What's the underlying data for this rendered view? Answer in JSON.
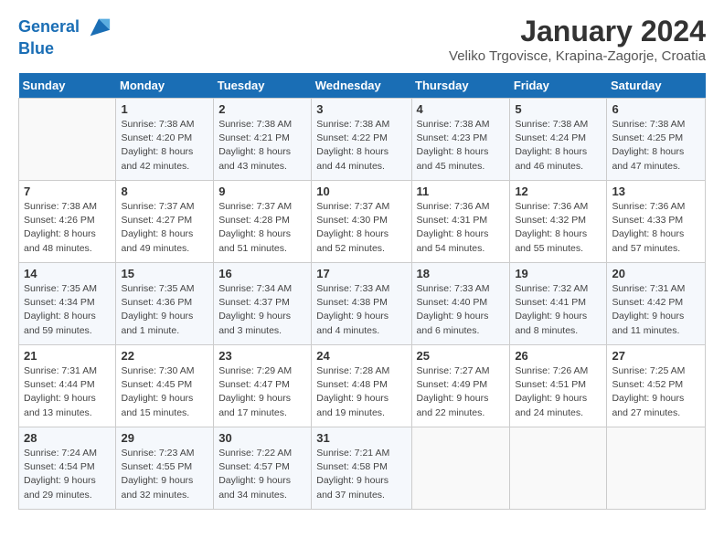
{
  "header": {
    "logo_line1": "General",
    "logo_line2": "Blue",
    "title": "January 2024",
    "subtitle": "Veliko Trgovisce, Krapina-Zagorje, Croatia"
  },
  "calendar": {
    "days_of_week": [
      "Sunday",
      "Monday",
      "Tuesday",
      "Wednesday",
      "Thursday",
      "Friday",
      "Saturday"
    ],
    "weeks": [
      [
        {
          "day": "",
          "info": ""
        },
        {
          "day": "1",
          "info": "Sunrise: 7:38 AM\nSunset: 4:20 PM\nDaylight: 8 hours\nand 42 minutes."
        },
        {
          "day": "2",
          "info": "Sunrise: 7:38 AM\nSunset: 4:21 PM\nDaylight: 8 hours\nand 43 minutes."
        },
        {
          "day": "3",
          "info": "Sunrise: 7:38 AM\nSunset: 4:22 PM\nDaylight: 8 hours\nand 44 minutes."
        },
        {
          "day": "4",
          "info": "Sunrise: 7:38 AM\nSunset: 4:23 PM\nDaylight: 8 hours\nand 45 minutes."
        },
        {
          "day": "5",
          "info": "Sunrise: 7:38 AM\nSunset: 4:24 PM\nDaylight: 8 hours\nand 46 minutes."
        },
        {
          "day": "6",
          "info": "Sunrise: 7:38 AM\nSunset: 4:25 PM\nDaylight: 8 hours\nand 47 minutes."
        }
      ],
      [
        {
          "day": "7",
          "info": "Sunrise: 7:38 AM\nSunset: 4:26 PM\nDaylight: 8 hours\nand 48 minutes."
        },
        {
          "day": "8",
          "info": "Sunrise: 7:37 AM\nSunset: 4:27 PM\nDaylight: 8 hours\nand 49 minutes."
        },
        {
          "day": "9",
          "info": "Sunrise: 7:37 AM\nSunset: 4:28 PM\nDaylight: 8 hours\nand 51 minutes."
        },
        {
          "day": "10",
          "info": "Sunrise: 7:37 AM\nSunset: 4:30 PM\nDaylight: 8 hours\nand 52 minutes."
        },
        {
          "day": "11",
          "info": "Sunrise: 7:36 AM\nSunset: 4:31 PM\nDaylight: 8 hours\nand 54 minutes."
        },
        {
          "day": "12",
          "info": "Sunrise: 7:36 AM\nSunset: 4:32 PM\nDaylight: 8 hours\nand 55 minutes."
        },
        {
          "day": "13",
          "info": "Sunrise: 7:36 AM\nSunset: 4:33 PM\nDaylight: 8 hours\nand 57 minutes."
        }
      ],
      [
        {
          "day": "14",
          "info": "Sunrise: 7:35 AM\nSunset: 4:34 PM\nDaylight: 8 hours\nand 59 minutes."
        },
        {
          "day": "15",
          "info": "Sunrise: 7:35 AM\nSunset: 4:36 PM\nDaylight: 9 hours\nand 1 minute."
        },
        {
          "day": "16",
          "info": "Sunrise: 7:34 AM\nSunset: 4:37 PM\nDaylight: 9 hours\nand 3 minutes."
        },
        {
          "day": "17",
          "info": "Sunrise: 7:33 AM\nSunset: 4:38 PM\nDaylight: 9 hours\nand 4 minutes."
        },
        {
          "day": "18",
          "info": "Sunrise: 7:33 AM\nSunset: 4:40 PM\nDaylight: 9 hours\nand 6 minutes."
        },
        {
          "day": "19",
          "info": "Sunrise: 7:32 AM\nSunset: 4:41 PM\nDaylight: 9 hours\nand 8 minutes."
        },
        {
          "day": "20",
          "info": "Sunrise: 7:31 AM\nSunset: 4:42 PM\nDaylight: 9 hours\nand 11 minutes."
        }
      ],
      [
        {
          "day": "21",
          "info": "Sunrise: 7:31 AM\nSunset: 4:44 PM\nDaylight: 9 hours\nand 13 minutes."
        },
        {
          "day": "22",
          "info": "Sunrise: 7:30 AM\nSunset: 4:45 PM\nDaylight: 9 hours\nand 15 minutes."
        },
        {
          "day": "23",
          "info": "Sunrise: 7:29 AM\nSunset: 4:47 PM\nDaylight: 9 hours\nand 17 minutes."
        },
        {
          "day": "24",
          "info": "Sunrise: 7:28 AM\nSunset: 4:48 PM\nDaylight: 9 hours\nand 19 minutes."
        },
        {
          "day": "25",
          "info": "Sunrise: 7:27 AM\nSunset: 4:49 PM\nDaylight: 9 hours\nand 22 minutes."
        },
        {
          "day": "26",
          "info": "Sunrise: 7:26 AM\nSunset: 4:51 PM\nDaylight: 9 hours\nand 24 minutes."
        },
        {
          "day": "27",
          "info": "Sunrise: 7:25 AM\nSunset: 4:52 PM\nDaylight: 9 hours\nand 27 minutes."
        }
      ],
      [
        {
          "day": "28",
          "info": "Sunrise: 7:24 AM\nSunset: 4:54 PM\nDaylight: 9 hours\nand 29 minutes."
        },
        {
          "day": "29",
          "info": "Sunrise: 7:23 AM\nSunset: 4:55 PM\nDaylight: 9 hours\nand 32 minutes."
        },
        {
          "day": "30",
          "info": "Sunrise: 7:22 AM\nSunset: 4:57 PM\nDaylight: 9 hours\nand 34 minutes."
        },
        {
          "day": "31",
          "info": "Sunrise: 7:21 AM\nSunset: 4:58 PM\nDaylight: 9 hours\nand 37 minutes."
        },
        {
          "day": "",
          "info": ""
        },
        {
          "day": "",
          "info": ""
        },
        {
          "day": "",
          "info": ""
        }
      ]
    ]
  }
}
